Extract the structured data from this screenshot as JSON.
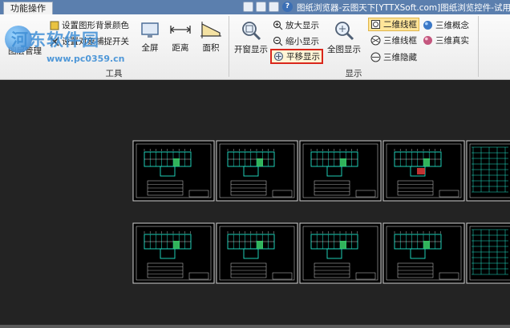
{
  "titlebar": {
    "tab_label": "功能操作",
    "window_title": "图纸浏览器-云图天下[YTTXSoft.com]图纸浏览控件-试用版"
  },
  "watermark": {
    "brand": "河东软件园",
    "url": "www.pc0359.cn"
  },
  "ribbon": {
    "tools_group": {
      "caption": "工具",
      "set_bg_color": "设置图形背景颜色",
      "snap_toggle": "设置对象捕捉开关",
      "layer_manage": "图层管理",
      "fullscreen": "全屏",
      "distance": "距离",
      "area": "面积"
    },
    "display_group": {
      "caption": "显示",
      "window_display": "开窗显示",
      "zoom_in": "放大显示",
      "zoom_out": "缩小显示",
      "pan_display": "平移显示",
      "full_display": "全图显示",
      "wire_2d": "二维线框",
      "wire_3d": "三维线框",
      "hidden_3d": "三维隐藏",
      "concept_3d": "三维概念",
      "realistic_3d": "三维真实"
    }
  },
  "colors": {
    "title_bar": "#5b7fae",
    "highlight_border": "#d9261c",
    "canvas_bg": "#232323",
    "drawing_line": "#22e3c9"
  }
}
